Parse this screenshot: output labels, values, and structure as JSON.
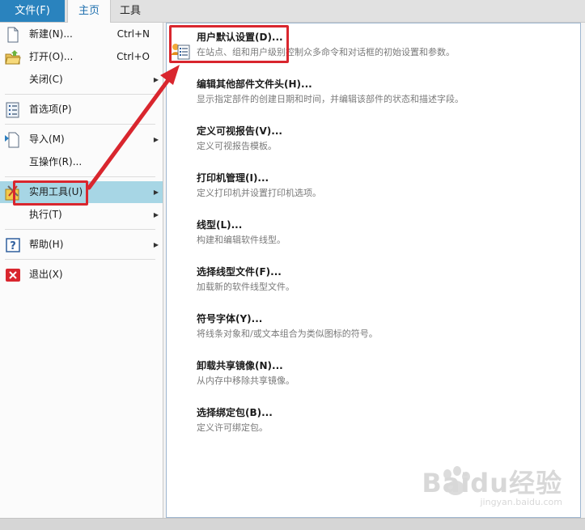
{
  "ribbon": {
    "tabs": [
      {
        "label": "文件(F)"
      },
      {
        "label": "主页"
      },
      {
        "label": "工具"
      }
    ]
  },
  "file_menu": {
    "items": [
      {
        "label": "新建(N)...",
        "shortcut": "Ctrl+N",
        "icon": "new-document-icon"
      },
      {
        "label": "打开(O)...",
        "shortcut": "Ctrl+O",
        "icon": "open-folder-icon"
      },
      {
        "label": "关闭(C)",
        "icon": "none"
      },
      {
        "label": "首选项(P)",
        "icon": "preferences-icon"
      },
      {
        "label": "导入(M)",
        "icon": "import-icon"
      },
      {
        "label": "互操作(R)...",
        "icon": "none"
      },
      {
        "label": "实用工具(U)",
        "icon": "utilities-icon",
        "selected": true
      },
      {
        "label": "执行(T)",
        "icon": "none"
      },
      {
        "label": "帮助(H)",
        "icon": "help-icon"
      },
      {
        "label": "退出(X)",
        "icon": "exit-icon"
      }
    ]
  },
  "utilities_submenu": {
    "items": [
      {
        "title": "用户默认设置(D)...",
        "desc": "在站点、组和用户级别控制众多命令和对话框的初始设置和参数。"
      },
      {
        "title": "编辑其他部件文件头(H)...",
        "desc": "显示指定部件的创建日期和时间，并编辑该部件的状态和描述字段。"
      },
      {
        "title": "定义可视报告(V)...",
        "desc": "定义可视报告模板。"
      },
      {
        "title": "打印机管理(I)...",
        "desc": "定义打印机并设置打印机选项。"
      },
      {
        "title": "线型(L)...",
        "desc": "构建和编辑软件线型。"
      },
      {
        "title": "选择线型文件(F)...",
        "desc": "加载新的软件线型文件。"
      },
      {
        "title": "符号字体(Y)...",
        "desc": "将线条对象和/或文本组合为类似图标的符号。"
      },
      {
        "title": "卸载共享镜像(N)...",
        "desc": "从内存中移除共享镜像。"
      },
      {
        "title": "选择绑定包(B)...",
        "desc": "定义许可绑定包。"
      }
    ]
  },
  "watermark": {
    "brand": "Baidu经验",
    "url": "jingyan.baidu.com"
  },
  "colors": {
    "accent": "#2a83be",
    "selected": "#a7d6e5",
    "annotation": "#d9262e"
  }
}
